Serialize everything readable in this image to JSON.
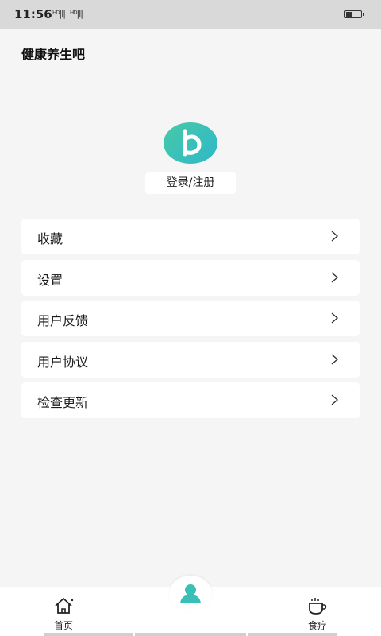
{
  "status_bar": {
    "time": "11:56",
    "signal_1": "ᴴᴰ|l|",
    "signal_2": "ᴴᴰ|l|"
  },
  "app": {
    "title": "健康养生吧"
  },
  "profile": {
    "login_label": "登录/注册"
  },
  "menu": {
    "items": [
      {
        "label": "收藏"
      },
      {
        "label": "设置"
      },
      {
        "label": "用户反馈"
      },
      {
        "label": "用户协议"
      },
      {
        "label": "检查更新"
      }
    ]
  },
  "tab_bar": {
    "tabs": [
      {
        "label": "首页",
        "icon": "home-icon"
      },
      {
        "label": "",
        "icon": "user-icon"
      },
      {
        "label": "食疗",
        "icon": "cup-icon"
      }
    ]
  },
  "colors": {
    "accent_teal": "#38c0b8",
    "background": "#f5f5f5",
    "card": "#ffffff"
  }
}
